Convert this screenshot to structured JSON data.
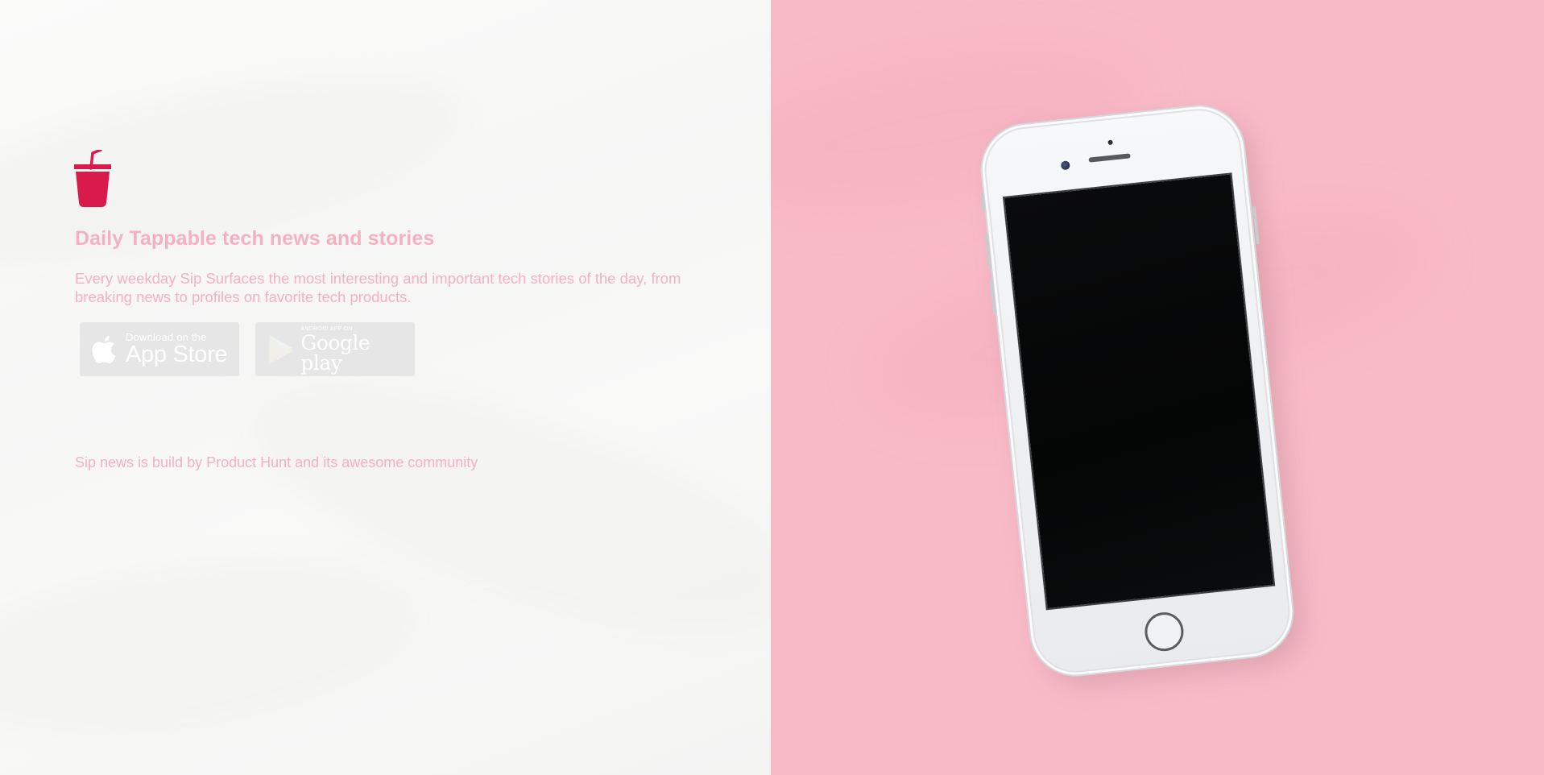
{
  "brand": {
    "logo_icon": "cup-with-straw-icon",
    "accent_color": "#d81b4a",
    "text_color": "#f4b1c1",
    "right_panel_color": "#f8bac6"
  },
  "hero": {
    "headline": "Daily Tappable tech news and stories",
    "description": "Every weekday Sip Surfaces the most interesting and important tech stories of the day, from breaking news to profiles on favorite tech products."
  },
  "store_buttons": {
    "app_store": {
      "icon": "apple-icon",
      "small_label": "Download on the",
      "big_label": "App Store"
    },
    "google_play": {
      "icon": "google-play-icon",
      "small_label": "Android app on",
      "big_label": "Google play"
    }
  },
  "footer": {
    "prefix": "Sip news is build by ",
    "link_label": "Product Hunt",
    "suffix": " and its awesome community"
  }
}
